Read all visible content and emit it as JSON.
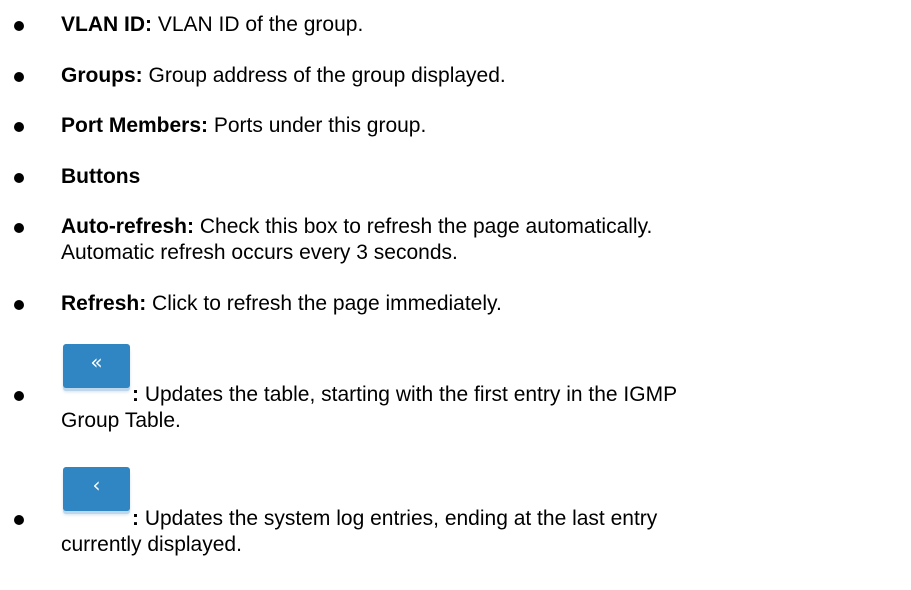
{
  "items": [
    {
      "term": "VLAN ID:",
      "desc": " VLAN ID of the group."
    },
    {
      "term": "Groups:",
      "desc": " Group address of the group displayed."
    },
    {
      "term": "Port Members:",
      "desc": " Ports under this group."
    },
    {
      "term": "Buttons",
      "desc": ""
    },
    {
      "term": "Auto-refresh:",
      "desc": " Check this box to refresh the page automatically.",
      "desc2": "Automatic refresh occurs every 3 seconds."
    },
    {
      "term": "Refresh:",
      "desc": " Click to refresh the page immediately."
    },
    {
      "icon": "first-page-icon",
      "icon_glyph": "«",
      "term": ":",
      "desc": " Updates the table, starting with the first entry in the IGMP",
      "desc2": "Group Table."
    },
    {
      "icon": "previous-page-icon",
      "icon_glyph": "‹",
      "term": ":",
      "desc": " Updates the system log entries, ending at the last entry",
      "desc2": "currently displayed."
    }
  ],
  "colors": {
    "text": "#000000",
    "button_fill": "#2f86c2",
    "button_glyph": "#ffffff"
  }
}
